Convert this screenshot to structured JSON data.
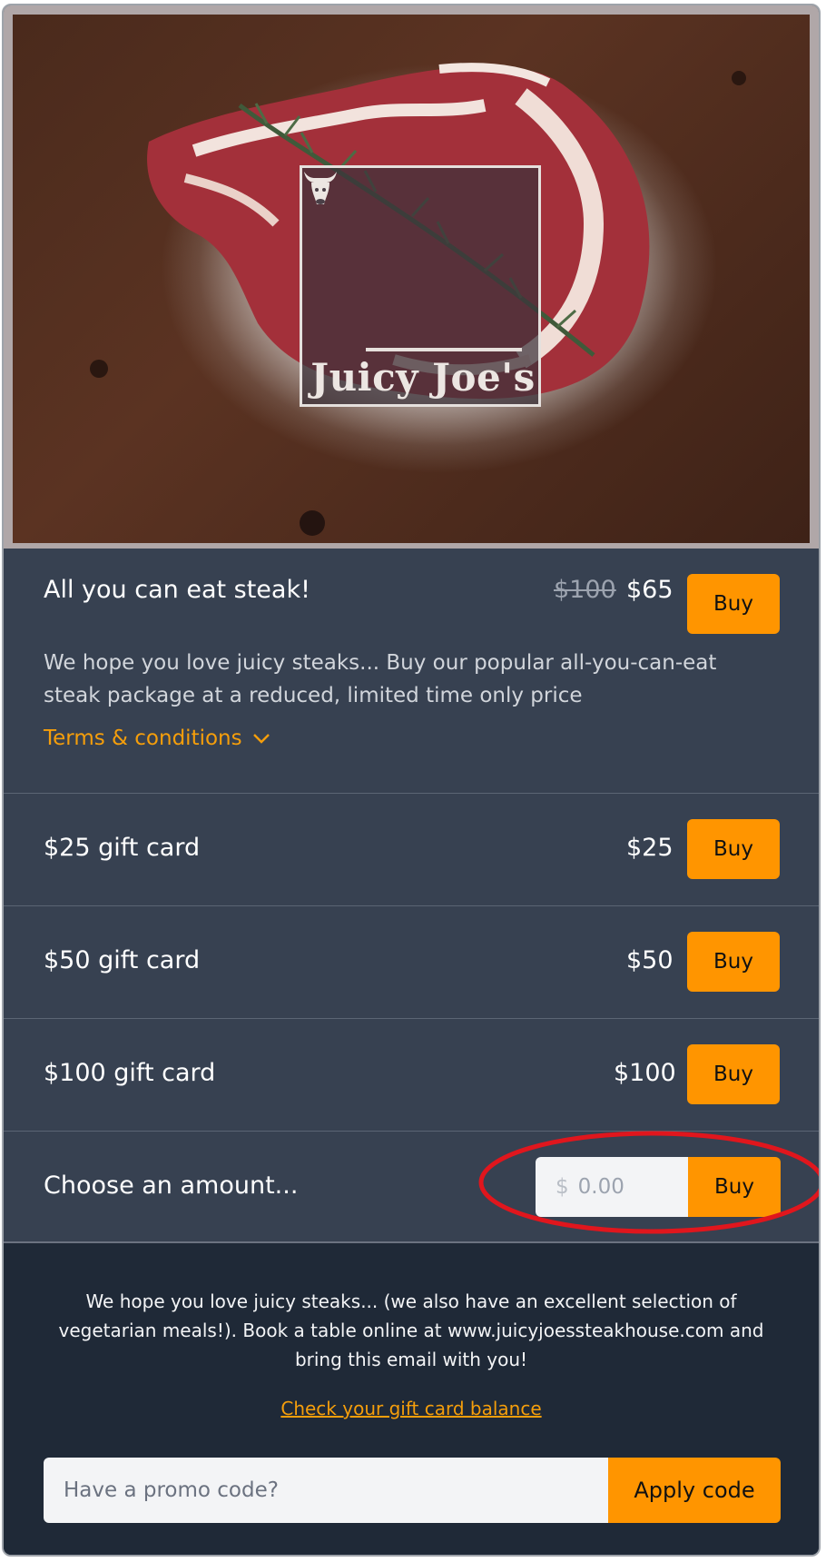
{
  "hero": {
    "brand_name": "Juicy Joe's",
    "logo_icon": "bull-head-icon"
  },
  "offers": [
    {
      "title": "All you can eat steak!",
      "original_price": "$100",
      "price": "$65",
      "buy_label": "Buy",
      "description": "We hope you love juicy steaks... Buy our popular all-you-can-eat steak package at a reduced, limited time only price",
      "terms_label": "Terms & conditions",
      "terms_icon": "chevron-down-icon"
    },
    {
      "title": "$25 gift card",
      "price": "$25",
      "buy_label": "Buy"
    },
    {
      "title": "$50 gift card",
      "price": "$50",
      "buy_label": "Buy"
    },
    {
      "title": "$100 gift card",
      "price": "$100",
      "buy_label": "Buy"
    }
  ],
  "custom_amount": {
    "title": "Choose an amount...",
    "currency_symbol": "$",
    "placeholder": "0.00",
    "buy_label": "Buy"
  },
  "footer": {
    "message": "We hope you love juicy steaks... (we also have an excellent selection of vegetarian meals!). Book a table online at www.juicyjoessteakhouse.com and bring this email with you!",
    "balance_link": "Check your gift card balance",
    "promo_placeholder": "Have a promo code?",
    "apply_label": "Apply code"
  },
  "colors": {
    "accent": "#ff9500",
    "link": "#f59e0b",
    "panel": "#374151",
    "footer": "#1f2937",
    "highlight": "#e0161d"
  }
}
